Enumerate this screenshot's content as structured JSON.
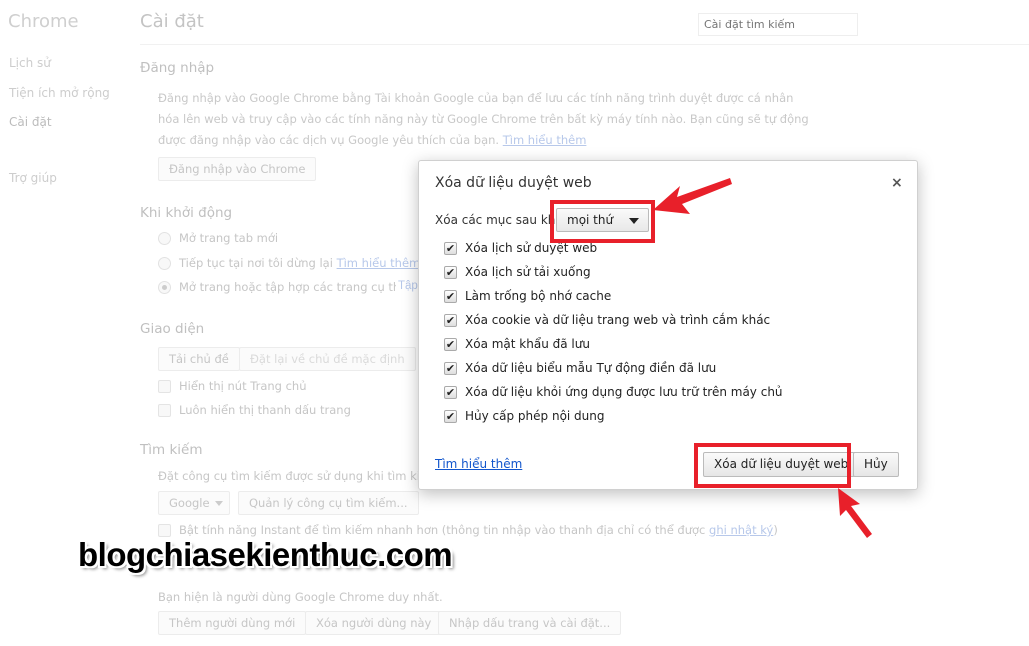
{
  "sidebar": {
    "title": "Chrome",
    "items": [
      "Lịch sử",
      "Tiện ích mở rộng",
      "Cài đặt",
      "Trợ giúp"
    ]
  },
  "header": {
    "title": "Cài đặt",
    "search_placeholder": "Cài đặt tìm kiếm"
  },
  "signin": {
    "heading": "Đăng nhập",
    "lines": [
      "Đăng nhập vào Google Chrome bằng Tài khoản Google của bạn để lưu các tính năng trình duyệt được cá nhân",
      "hóa lên web và truy cập vào các tính năng này từ Google Chrome trên bất kỳ máy tính nào. Bạn cũng sẽ tự động",
      "được đăng nhập vào các dịch vụ Google yêu thích của bạn."
    ],
    "link": "Tìm hiểu thêm",
    "button": "Đăng nhập vào Chrome"
  },
  "startup": {
    "heading": "Khi khởi động",
    "options": [
      "Mở trang tab mới",
      "Tiếp tục tại nơi tôi dừng lại",
      "Mở trang hoặc tập hợp các trang cụ thể."
    ],
    "link": "Tìm hiểu thêm",
    "set_pages": "Tập"
  },
  "appearance": {
    "heading": "Giao diện",
    "get_themes": "Tải chủ đề",
    "reset_theme": "Đặt lại về chủ đề mặc định",
    "show_home": "Hiển thị nút Trang chủ",
    "show_bookmarks": "Luôn hiển thị thanh dấu trang"
  },
  "search": {
    "heading": "Tìm kiếm",
    "desc": "Đặt công cụ tìm kiếm được sử dụng khi tìm kiếm",
    "engine": "Google",
    "manage": "Quản lý công cụ tìm kiếm...",
    "instant": "Bật tính năng Instant để tìm kiếm nhanh hơn (thông tin nhập vào thanh địa chỉ có thể được",
    "instant_link": "ghi nhật ký",
    "instant_end": ")"
  },
  "users": {
    "desc": "Bạn hiện là người dùng Google Chrome duy nhất.",
    "add": "Thêm người dùng mới",
    "delete": "Xóa người dùng này",
    "import": "Nhập dấu trang và cài đặt..."
  },
  "dialog": {
    "title": "Xóa dữ liệu duyệt web",
    "close": "×",
    "range_label": "Xóa các mục sau khỏi",
    "range_value": "mọi thứ",
    "items": [
      {
        "label": "Xóa lịch sử duyệt web",
        "checked": true
      },
      {
        "label": "Xóa lịch sử tải xuống",
        "checked": true
      },
      {
        "label": "Làm trống bộ nhớ cache",
        "checked": true
      },
      {
        "label": "Xóa cookie và dữ liệu trang web và trình cắm khác",
        "checked": true
      },
      {
        "label": "Xóa mật khẩu đã lưu",
        "checked": true
      },
      {
        "label": "Xóa dữ liệu biểu mẫu Tự động điền đã lưu",
        "checked": true
      },
      {
        "label": "Xóa dữ liệu khỏi ứng dụng được lưu trữ trên máy chủ",
        "checked": true
      },
      {
        "label": "Hủy cấp phép nội dung",
        "checked": true
      }
    ],
    "learn_more": "Tìm hiểu thêm",
    "clear_button": "Xóa dữ liệu duyệt web",
    "cancel_button": "Hủy"
  },
  "watermark": "blogchiasekienthuc.com",
  "colors": {
    "highlight": "#e8202a",
    "link": "#1155cc"
  }
}
